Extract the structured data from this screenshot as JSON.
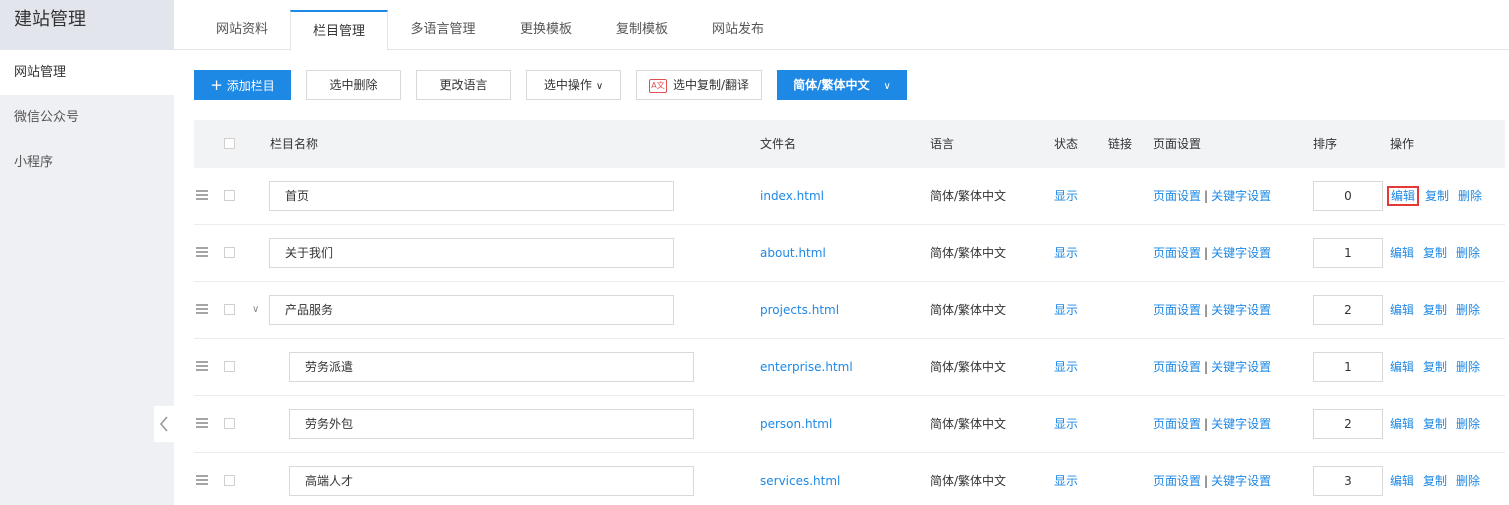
{
  "sidebar": {
    "title": "建站管理",
    "items": [
      {
        "label": "网站管理",
        "active": true
      },
      {
        "label": "微信公众号",
        "active": false
      },
      {
        "label": "小程序",
        "active": false
      }
    ]
  },
  "tabs": [
    {
      "label": "网站资料",
      "active": false
    },
    {
      "label": "栏目管理",
      "active": true
    },
    {
      "label": "多语言管理",
      "active": false
    },
    {
      "label": "更换模板",
      "active": false
    },
    {
      "label": "复制模板",
      "active": false
    },
    {
      "label": "网站发布",
      "active": false
    }
  ],
  "toolbar": {
    "add_label": "添加栏目",
    "delete_selected_label": "选中删除",
    "change_language_label": "更改语言",
    "select_ops_label": "选中操作",
    "copy_translate_label": "选中复制/翻译",
    "language_select_label": "简体/繁体中文"
  },
  "table": {
    "headers": {
      "name": "栏目名称",
      "filename": "文件名",
      "language": "语言",
      "status": "状态",
      "link": "链接",
      "page_settings": "页面设置",
      "sort": "排序",
      "ops": "操作"
    },
    "rows": [
      {
        "name": "首页",
        "filename": "index.html",
        "language": "简体/繁体中文",
        "status": "显示",
        "page_setting": "页面设置",
        "keyword_setting": "关键字设置",
        "sort": "0",
        "edit": "编辑",
        "copy": "复制",
        "delete": "删除",
        "level": 0,
        "expandable": false,
        "highlight_edit": true
      },
      {
        "name": "关于我们",
        "filename": "about.html",
        "language": "简体/繁体中文",
        "status": "显示",
        "page_setting": "页面设置",
        "keyword_setting": "关键字设置",
        "sort": "1",
        "edit": "编辑",
        "copy": "复制",
        "delete": "删除",
        "level": 0,
        "expandable": false,
        "highlight_edit": false
      },
      {
        "name": "产品服务",
        "filename": "projects.html",
        "language": "简体/繁体中文",
        "status": "显示",
        "page_setting": "页面设置",
        "keyword_setting": "关键字设置",
        "sort": "2",
        "edit": "编辑",
        "copy": "复制",
        "delete": "删除",
        "level": 0,
        "expandable": true,
        "highlight_edit": false
      },
      {
        "name": "劳务派遣",
        "filename": "enterprise.html",
        "language": "简体/繁体中文",
        "status": "显示",
        "page_setting": "页面设置",
        "keyword_setting": "关键字设置",
        "sort": "1",
        "edit": "编辑",
        "copy": "复制",
        "delete": "删除",
        "level": 1,
        "expandable": false,
        "highlight_edit": false
      },
      {
        "name": "劳务外包",
        "filename": "person.html",
        "language": "简体/繁体中文",
        "status": "显示",
        "page_setting": "页面设置",
        "keyword_setting": "关键字设置",
        "sort": "2",
        "edit": "编辑",
        "copy": "复制",
        "delete": "删除",
        "level": 1,
        "expandable": false,
        "highlight_edit": false
      },
      {
        "name": "高端人才",
        "filename": "services.html",
        "language": "简体/繁体中文",
        "status": "显示",
        "page_setting": "页面设置",
        "keyword_setting": "关键字设置",
        "sort": "3",
        "edit": "编辑",
        "copy": "复制",
        "delete": "删除",
        "level": 1,
        "expandable": false,
        "highlight_edit": false
      }
    ]
  },
  "icons": {
    "add": "plus-icon",
    "dropdown": "chevron-down-icon",
    "translate": "translate-icon",
    "drag": "drag-handle-icon",
    "collapse": "chevron-left-icon",
    "expand": "chevron-down-icon"
  },
  "colors": {
    "accent": "#1e88e5",
    "highlight": "#e53935",
    "sidebar_bg": "#eff0f4"
  }
}
